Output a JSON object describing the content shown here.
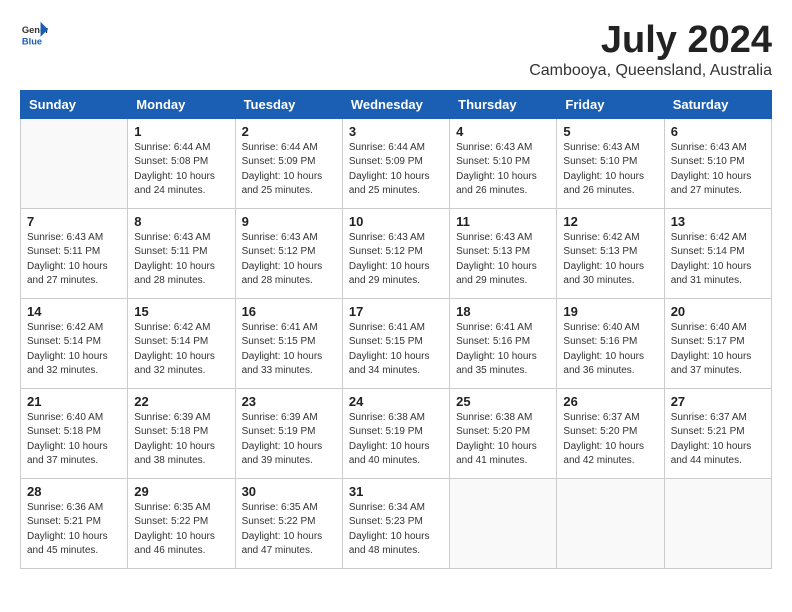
{
  "header": {
    "logo_general": "General",
    "logo_blue": "Blue",
    "month_year": "July 2024",
    "location": "Cambooya, Queensland, Australia"
  },
  "days_of_week": [
    "Sunday",
    "Monday",
    "Tuesday",
    "Wednesday",
    "Thursday",
    "Friday",
    "Saturday"
  ],
  "weeks": [
    [
      {
        "day": "",
        "info": ""
      },
      {
        "day": "1",
        "info": "Sunrise: 6:44 AM\nSunset: 5:08 PM\nDaylight: 10 hours\nand 24 minutes."
      },
      {
        "day": "2",
        "info": "Sunrise: 6:44 AM\nSunset: 5:09 PM\nDaylight: 10 hours\nand 25 minutes."
      },
      {
        "day": "3",
        "info": "Sunrise: 6:44 AM\nSunset: 5:09 PM\nDaylight: 10 hours\nand 25 minutes."
      },
      {
        "day": "4",
        "info": "Sunrise: 6:43 AM\nSunset: 5:10 PM\nDaylight: 10 hours\nand 26 minutes."
      },
      {
        "day": "5",
        "info": "Sunrise: 6:43 AM\nSunset: 5:10 PM\nDaylight: 10 hours\nand 26 minutes."
      },
      {
        "day": "6",
        "info": "Sunrise: 6:43 AM\nSunset: 5:10 PM\nDaylight: 10 hours\nand 27 minutes."
      }
    ],
    [
      {
        "day": "7",
        "info": "Sunrise: 6:43 AM\nSunset: 5:11 PM\nDaylight: 10 hours\nand 27 minutes."
      },
      {
        "day": "8",
        "info": "Sunrise: 6:43 AM\nSunset: 5:11 PM\nDaylight: 10 hours\nand 28 minutes."
      },
      {
        "day": "9",
        "info": "Sunrise: 6:43 AM\nSunset: 5:12 PM\nDaylight: 10 hours\nand 28 minutes."
      },
      {
        "day": "10",
        "info": "Sunrise: 6:43 AM\nSunset: 5:12 PM\nDaylight: 10 hours\nand 29 minutes."
      },
      {
        "day": "11",
        "info": "Sunrise: 6:43 AM\nSunset: 5:13 PM\nDaylight: 10 hours\nand 29 minutes."
      },
      {
        "day": "12",
        "info": "Sunrise: 6:42 AM\nSunset: 5:13 PM\nDaylight: 10 hours\nand 30 minutes."
      },
      {
        "day": "13",
        "info": "Sunrise: 6:42 AM\nSunset: 5:14 PM\nDaylight: 10 hours\nand 31 minutes."
      }
    ],
    [
      {
        "day": "14",
        "info": "Sunrise: 6:42 AM\nSunset: 5:14 PM\nDaylight: 10 hours\nand 32 minutes."
      },
      {
        "day": "15",
        "info": "Sunrise: 6:42 AM\nSunset: 5:14 PM\nDaylight: 10 hours\nand 32 minutes."
      },
      {
        "day": "16",
        "info": "Sunrise: 6:41 AM\nSunset: 5:15 PM\nDaylight: 10 hours\nand 33 minutes."
      },
      {
        "day": "17",
        "info": "Sunrise: 6:41 AM\nSunset: 5:15 PM\nDaylight: 10 hours\nand 34 minutes."
      },
      {
        "day": "18",
        "info": "Sunrise: 6:41 AM\nSunset: 5:16 PM\nDaylight: 10 hours\nand 35 minutes."
      },
      {
        "day": "19",
        "info": "Sunrise: 6:40 AM\nSunset: 5:16 PM\nDaylight: 10 hours\nand 36 minutes."
      },
      {
        "day": "20",
        "info": "Sunrise: 6:40 AM\nSunset: 5:17 PM\nDaylight: 10 hours\nand 37 minutes."
      }
    ],
    [
      {
        "day": "21",
        "info": "Sunrise: 6:40 AM\nSunset: 5:18 PM\nDaylight: 10 hours\nand 37 minutes."
      },
      {
        "day": "22",
        "info": "Sunrise: 6:39 AM\nSunset: 5:18 PM\nDaylight: 10 hours\nand 38 minutes."
      },
      {
        "day": "23",
        "info": "Sunrise: 6:39 AM\nSunset: 5:19 PM\nDaylight: 10 hours\nand 39 minutes."
      },
      {
        "day": "24",
        "info": "Sunrise: 6:38 AM\nSunset: 5:19 PM\nDaylight: 10 hours\nand 40 minutes."
      },
      {
        "day": "25",
        "info": "Sunrise: 6:38 AM\nSunset: 5:20 PM\nDaylight: 10 hours\nand 41 minutes."
      },
      {
        "day": "26",
        "info": "Sunrise: 6:37 AM\nSunset: 5:20 PM\nDaylight: 10 hours\nand 42 minutes."
      },
      {
        "day": "27",
        "info": "Sunrise: 6:37 AM\nSunset: 5:21 PM\nDaylight: 10 hours\nand 44 minutes."
      }
    ],
    [
      {
        "day": "28",
        "info": "Sunrise: 6:36 AM\nSunset: 5:21 PM\nDaylight: 10 hours\nand 45 minutes."
      },
      {
        "day": "29",
        "info": "Sunrise: 6:35 AM\nSunset: 5:22 PM\nDaylight: 10 hours\nand 46 minutes."
      },
      {
        "day": "30",
        "info": "Sunrise: 6:35 AM\nSunset: 5:22 PM\nDaylight: 10 hours\nand 47 minutes."
      },
      {
        "day": "31",
        "info": "Sunrise: 6:34 AM\nSunset: 5:23 PM\nDaylight: 10 hours\nand 48 minutes."
      },
      {
        "day": "",
        "info": ""
      },
      {
        "day": "",
        "info": ""
      },
      {
        "day": "",
        "info": ""
      }
    ]
  ]
}
